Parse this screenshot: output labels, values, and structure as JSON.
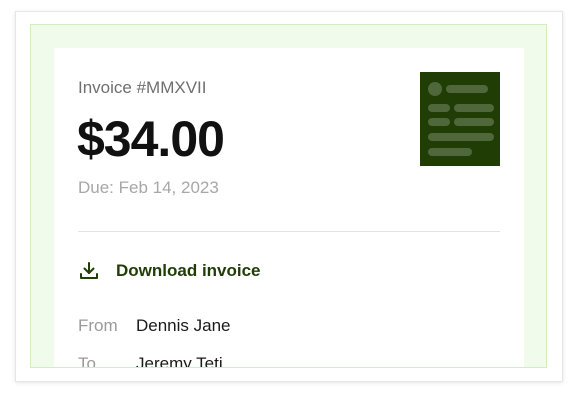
{
  "invoice": {
    "number": "Invoice #MMXVII",
    "amount": "$34.00",
    "due": "Due: Feb 14, 2023",
    "download_label": "Download invoice",
    "from_label": "From",
    "from_value": "Dennis Jane",
    "to_label": "To",
    "to_value": "Jeremy Teti"
  },
  "colors": {
    "accent": "#1f3d05",
    "preview_bg": "#f1fbeb"
  },
  "icons": {
    "download": "download-icon",
    "thumbnail": "invoice-thumbnail"
  }
}
